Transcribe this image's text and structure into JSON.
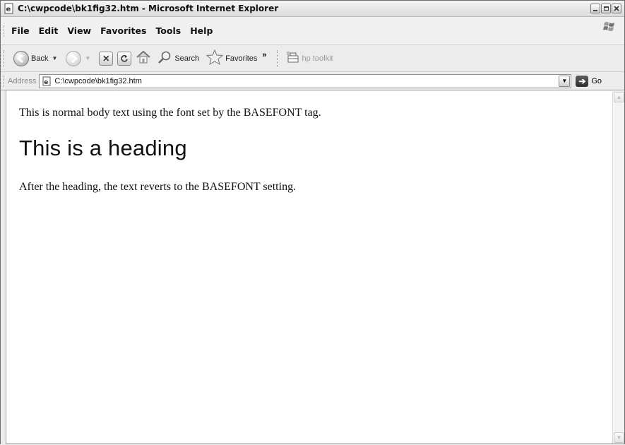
{
  "window": {
    "title": "C:\\cwpcode\\bk1fig32.htm - Microsoft Internet Explorer"
  },
  "menu": {
    "items": [
      "File",
      "Edit",
      "View",
      "Favorites",
      "Tools",
      "Help"
    ]
  },
  "toolbar": {
    "back_label": "Back",
    "search_label": "Search",
    "favorites_label": "Favorites",
    "more_label": "»",
    "hp_label": "hp toolkit"
  },
  "address": {
    "label": "Address",
    "value": "C:\\cwpcode\\bk1fig32.htm",
    "go_label": "Go"
  },
  "page": {
    "para1": "This is normal body text using the font set by the BASEFONT tag.",
    "heading": "This is a heading",
    "para2": "After the heading, the text reverts to the BASEFONT setting."
  },
  "icons": {
    "window": "ie-page-icon",
    "back": "back-arrow-icon",
    "forward": "forward-arrow-icon",
    "stop": "stop-icon",
    "refresh": "refresh-icon",
    "home": "home-icon",
    "search": "search-magnifier-icon",
    "favorites": "favorites-star-icon",
    "hp": "hp-toolkit-icon",
    "go": "go-arrow-icon"
  }
}
